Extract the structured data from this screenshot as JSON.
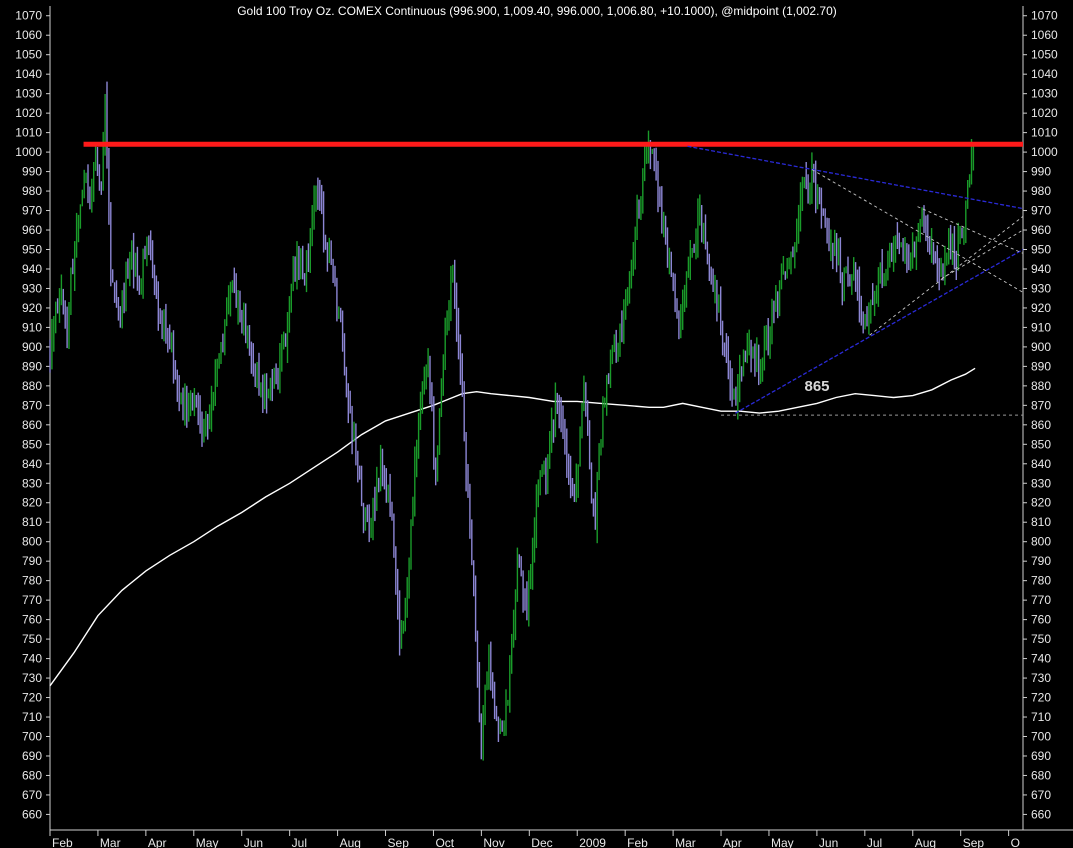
{
  "chart_data": {
    "type": "ohlc",
    "title": "Gold 100 Troy Oz. COMEX Continuous (996.900, 1,009.40, 996.000, 1,006.80, +10.1000), @midpoint (1,002.70)",
    "ylim": [
      652,
      1075
    ],
    "y_ticks": [
      660,
      670,
      680,
      690,
      700,
      710,
      720,
      730,
      740,
      750,
      760,
      770,
      780,
      790,
      800,
      810,
      820,
      830,
      840,
      850,
      860,
      870,
      880,
      890,
      900,
      910,
      920,
      930,
      940,
      950,
      960,
      970,
      980,
      990,
      1000,
      1010,
      1020,
      1030,
      1040,
      1050,
      1060,
      1070
    ],
    "x_labels": [
      "Feb",
      "Mar",
      "Apr",
      "May",
      "Jun",
      "Jul",
      "Aug",
      "Sep",
      "Oct",
      "Nov",
      "Dec",
      "2009",
      "Feb",
      "Mar",
      "Apr",
      "May",
      "Jun",
      "Jul",
      "Aug",
      "Sep",
      "O"
    ],
    "x_label_months": [
      0,
      1,
      2,
      3,
      4,
      5,
      6,
      7,
      8,
      9,
      10,
      11,
      12,
      13,
      14,
      15,
      16,
      17,
      18,
      19,
      20
    ],
    "xlim": [
      0,
      20.3
    ],
    "price_path": [
      [
        0.0,
        895
      ],
      [
        0.2,
        930
      ],
      [
        0.35,
        910
      ],
      [
        0.55,
        960
      ],
      [
        0.75,
        990
      ],
      [
        0.85,
        975
      ],
      [
        0.98,
        1002
      ],
      [
        1.05,
        970
      ],
      [
        1.15,
        1034
      ],
      [
        1.25,
        945
      ],
      [
        1.45,
        915
      ],
      [
        1.7,
        950
      ],
      [
        1.85,
        930
      ],
      [
        2.05,
        960
      ],
      [
        2.3,
        915
      ],
      [
        2.55,
        895
      ],
      [
        2.75,
        865
      ],
      [
        3.0,
        875
      ],
      [
        3.2,
        855
      ],
      [
        3.5,
        890
      ],
      [
        3.8,
        930
      ],
      [
        4.1,
        905
      ],
      [
        4.35,
        880
      ],
      [
        4.6,
        880
      ],
      [
        4.9,
        900
      ],
      [
        5.15,
        945
      ],
      [
        5.35,
        940
      ],
      [
        5.55,
        987
      ],
      [
        5.75,
        955
      ],
      [
        5.95,
        930
      ],
      [
        6.2,
        880
      ],
      [
        6.45,
        830
      ],
      [
        6.65,
        800
      ],
      [
        6.9,
        840
      ],
      [
        7.1,
        820
      ],
      [
        7.3,
        745
      ],
      [
        7.5,
        790
      ],
      [
        7.7,
        870
      ],
      [
        7.9,
        890
      ],
      [
        8.05,
        830
      ],
      [
        8.25,
        910
      ],
      [
        8.4,
        935
      ],
      [
        8.6,
        870
      ],
      [
        8.8,
        790
      ],
      [
        9.0,
        695
      ],
      [
        9.15,
        745
      ],
      [
        9.35,
        700
      ],
      [
        9.55,
        720
      ],
      [
        9.75,
        790
      ],
      [
        9.95,
        760
      ],
      [
        10.15,
        820
      ],
      [
        10.35,
        840
      ],
      [
        10.55,
        870
      ],
      [
        10.75,
        850
      ],
      [
        10.95,
        820
      ],
      [
        11.15,
        885
      ],
      [
        11.35,
        805
      ],
      [
        11.55,
        875
      ],
      [
        11.75,
        895
      ],
      [
        12.0,
        915
      ],
      [
        12.2,
        955
      ],
      [
        12.35,
        985
      ],
      [
        12.55,
        1005
      ],
      [
        12.7,
        975
      ],
      [
        12.9,
        945
      ],
      [
        13.1,
        910
      ],
      [
        13.3,
        935
      ],
      [
        13.55,
        970
      ],
      [
        13.75,
        940
      ],
      [
        13.95,
        920
      ],
      [
        14.15,
        890
      ],
      [
        14.3,
        870
      ],
      [
        14.55,
        905
      ],
      [
        14.8,
        890
      ],
      [
        15.0,
        910
      ],
      [
        15.25,
        935
      ],
      [
        15.5,
        950
      ],
      [
        15.7,
        980
      ],
      [
        15.9,
        990
      ],
      [
        16.1,
        965
      ],
      [
        16.35,
        950
      ],
      [
        16.55,
        935
      ],
      [
        16.8,
        940
      ],
      [
        17.0,
        910
      ],
      [
        17.2,
        930
      ],
      [
        17.45,
        945
      ],
      [
        17.7,
        950
      ],
      [
        17.95,
        940
      ],
      [
        18.15,
        968
      ],
      [
        18.35,
        955
      ],
      [
        18.55,
        935
      ],
      [
        18.75,
        950
      ],
      [
        18.9,
        945
      ],
      [
        19.05,
        960
      ],
      [
        19.2,
        990
      ],
      [
        19.3,
        1006
      ]
    ],
    "moving_average": [
      [
        0.0,
        726
      ],
      [
        0.5,
        743
      ],
      [
        1.0,
        762
      ],
      [
        1.5,
        775
      ],
      [
        2.0,
        785
      ],
      [
        2.5,
        793
      ],
      [
        3.0,
        800
      ],
      [
        3.5,
        808
      ],
      [
        4.0,
        815
      ],
      [
        4.5,
        823
      ],
      [
        5.0,
        830
      ],
      [
        5.5,
        838
      ],
      [
        6.0,
        846
      ],
      [
        6.5,
        855
      ],
      [
        7.0,
        862
      ],
      [
        7.5,
        866
      ],
      [
        8.0,
        870
      ],
      [
        8.3,
        873
      ],
      [
        8.6,
        876
      ],
      [
        8.9,
        877
      ],
      [
        9.2,
        876
      ],
      [
        9.6,
        875
      ],
      [
        10.0,
        874
      ],
      [
        10.5,
        872
      ],
      [
        11.0,
        872
      ],
      [
        11.5,
        871
      ],
      [
        12.0,
        870
      ],
      [
        12.5,
        869
      ],
      [
        12.8,
        869
      ],
      [
        13.2,
        871
      ],
      [
        13.6,
        869
      ],
      [
        14.0,
        867
      ],
      [
        14.4,
        867
      ],
      [
        14.8,
        866
      ],
      [
        15.2,
        867
      ],
      [
        15.6,
        869
      ],
      [
        16.0,
        871
      ],
      [
        16.4,
        874
      ],
      [
        16.8,
        876
      ],
      [
        17.2,
        875
      ],
      [
        17.6,
        874
      ],
      [
        18.0,
        875
      ],
      [
        18.4,
        878
      ],
      [
        18.8,
        883
      ],
      [
        19.1,
        886
      ],
      [
        19.3,
        889
      ]
    ],
    "resistance_level": 1004,
    "resistance_x": [
      0.7,
      20.3
    ],
    "support_level": 865,
    "support_x": [
      14.0,
      20.3
    ],
    "support_label": "865",
    "trendlines_blue": [
      {
        "x": [
          13.3,
          20.3
        ],
        "y": [
          1003,
          971
        ]
      },
      {
        "x": [
          14.3,
          20.3
        ],
        "y": [
          866,
          950
        ]
      }
    ],
    "trendlines_dashed": [
      {
        "x": [
          15.9,
          20.3
        ],
        "y": [
          991,
          928
        ]
      },
      {
        "x": [
          17.1,
          20.3
        ],
        "y": [
          906,
          967
        ]
      },
      {
        "x": [
          18.1,
          20.3
        ],
        "y": [
          972,
          948
        ]
      },
      {
        "x": [
          18.6,
          20.3
        ],
        "y": [
          935,
          960
        ]
      }
    ],
    "colors": {
      "background": "#000000",
      "up_bar": "#1a9b2a",
      "down_bar": "#8c86d4",
      "moving_average": "#ffffff",
      "resistance": "#ff1a1a",
      "blue_trendline": "#2a2ad8",
      "dashed_trendline": "#c8c8c8",
      "support_line": "#9a9a9a",
      "axis_text": "#e8e8e8"
    }
  }
}
